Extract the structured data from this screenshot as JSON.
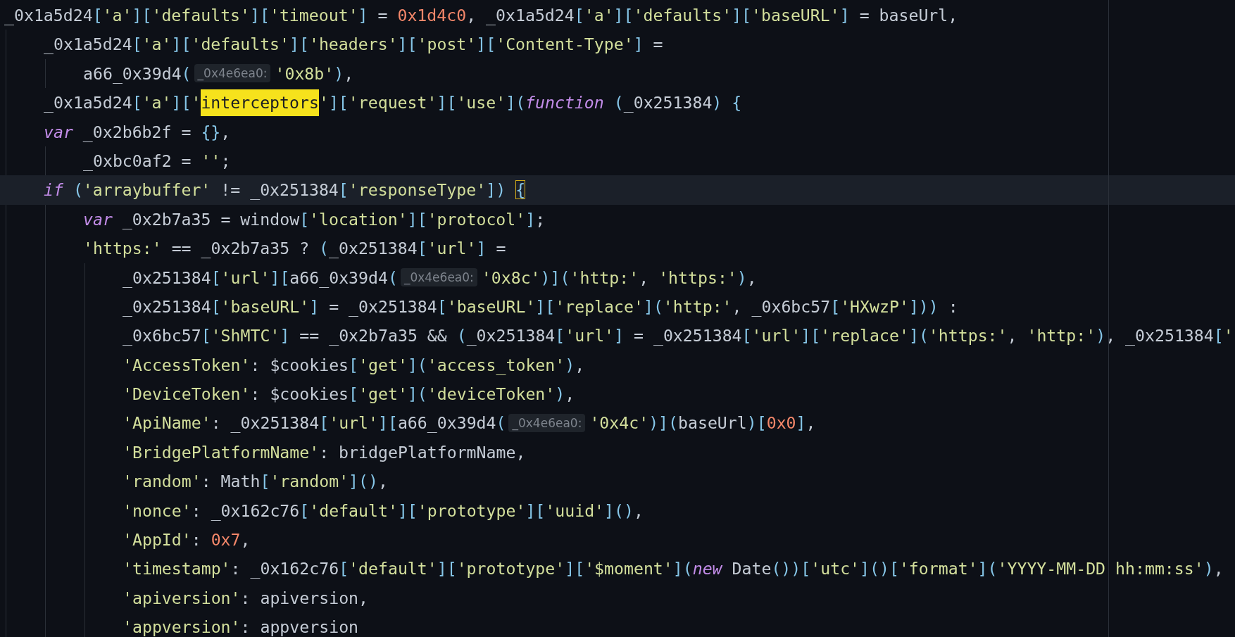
{
  "lines": [
    {
      "current": false,
      "tokens": [
        {
          "kind": "id",
          "text": "_0x1a5d24"
        },
        {
          "kind": "p",
          "text": "["
        },
        {
          "kind": "s",
          "text": "'a'"
        },
        {
          "kind": "p",
          "text": "]["
        },
        {
          "kind": "s",
          "text": "'defaults'"
        },
        {
          "kind": "p",
          "text": "]["
        },
        {
          "kind": "s",
          "text": "'timeout'"
        },
        {
          "kind": "p",
          "text": "]"
        },
        {
          "kind": "id",
          "text": " = "
        },
        {
          "kind": "n",
          "text": "0x1d4c0"
        },
        {
          "kind": "id",
          "text": ", _0x1a5d24"
        },
        {
          "kind": "p",
          "text": "["
        },
        {
          "kind": "s",
          "text": "'a'"
        },
        {
          "kind": "p",
          "text": "]["
        },
        {
          "kind": "s",
          "text": "'defaults'"
        },
        {
          "kind": "p",
          "text": "]["
        },
        {
          "kind": "s",
          "text": "'baseURL'"
        },
        {
          "kind": "p",
          "text": "]"
        },
        {
          "kind": "id",
          "text": " = baseUrl,"
        }
      ],
      "children": [
        {
          "current": false,
          "tokens": [
            {
              "kind": "id",
              "text": "_0x1a5d24"
            },
            {
              "kind": "p",
              "text": "["
            },
            {
              "kind": "s",
              "text": "'a'"
            },
            {
              "kind": "p",
              "text": "]["
            },
            {
              "kind": "s",
              "text": "'defaults'"
            },
            {
              "kind": "p",
              "text": "]["
            },
            {
              "kind": "s",
              "text": "'headers'"
            },
            {
              "kind": "p",
              "text": "]["
            },
            {
              "kind": "s",
              "text": "'post'"
            },
            {
              "kind": "p",
              "text": "]["
            },
            {
              "kind": "s",
              "text": "'Content-Type'"
            },
            {
              "kind": "p",
              "text": "]"
            },
            {
              "kind": "id",
              "text": " ="
            }
          ],
          "children": [
            {
              "current": false,
              "tokens": [
                {
                  "kind": "id",
                  "text": "a66_0x39d4"
                },
                {
                  "kind": "p",
                  "text": "("
                },
                {
                  "kind": "hint",
                  "text": "_0x4e6ea0:"
                },
                {
                  "kind": "s",
                  "text": "'0x8b'"
                },
                {
                  "kind": "p",
                  "text": ")"
                },
                {
                  "kind": "id",
                  "text": ","
                }
              ]
            }
          ]
        },
        {
          "current": false,
          "tokens": [
            {
              "kind": "id",
              "text": "_0x1a5d24"
            },
            {
              "kind": "p",
              "text": "["
            },
            {
              "kind": "s",
              "text": "'a'"
            },
            {
              "kind": "p",
              "text": "]["
            },
            {
              "kind": "s",
              "text": "'"
            },
            {
              "kind": "match",
              "text": "interceptors"
            },
            {
              "kind": "s",
              "text": "'"
            },
            {
              "kind": "p",
              "text": "]["
            },
            {
              "kind": "s",
              "text": "'request'"
            },
            {
              "kind": "p",
              "text": "]["
            },
            {
              "kind": "s",
              "text": "'use'"
            },
            {
              "kind": "p",
              "text": "]("
            },
            {
              "kind": "kw",
              "text": "function"
            },
            {
              "kind": "p",
              "text": " ("
            },
            {
              "kind": "id",
              "text": "_0x251384"
            },
            {
              "kind": "p",
              "text": ") {"
            }
          ]
        },
        {
          "current": false,
          "tokens": [
            {
              "kind": "kw",
              "text": "var"
            },
            {
              "kind": "id",
              "text": " _0x2b6b2f = "
            },
            {
              "kind": "p",
              "text": "{}"
            },
            {
              "kind": "id",
              "text": ","
            }
          ],
          "children": [
            {
              "current": false,
              "tokens": [
                {
                  "kind": "id",
                  "text": "_0xbc0af2 = "
                },
                {
                  "kind": "s",
                  "text": "''"
                },
                {
                  "kind": "id",
                  "text": ";"
                }
              ]
            }
          ]
        },
        {
          "current": true,
          "tokens": [
            {
              "kind": "kw",
              "text": "if"
            },
            {
              "kind": "p",
              "text": " ("
            },
            {
              "kind": "s",
              "text": "'arraybuffer'"
            },
            {
              "kind": "id",
              "text": " != _0x251384"
            },
            {
              "kind": "p",
              "text": "["
            },
            {
              "kind": "s",
              "text": "'responseType'"
            },
            {
              "kind": "p",
              "text": "]) "
            },
            {
              "kind": "brace",
              "text": "{"
            }
          ],
          "children": [
            {
              "current": false,
              "tokens": [
                {
                  "kind": "kw",
                  "text": "var"
                },
                {
                  "kind": "id",
                  "text": " _0x2b7a35 = window"
                },
                {
                  "kind": "p",
                  "text": "["
                },
                {
                  "kind": "s",
                  "text": "'location'"
                },
                {
                  "kind": "p",
                  "text": "]["
                },
                {
                  "kind": "s",
                  "text": "'protocol'"
                },
                {
                  "kind": "p",
                  "text": "]"
                },
                {
                  "kind": "id",
                  "text": ";"
                }
              ]
            },
            {
              "current": false,
              "tokens": [
                {
                  "kind": "s",
                  "text": "'https:'"
                },
                {
                  "kind": "id",
                  "text": " == _0x2b7a35 ? "
                },
                {
                  "kind": "p",
                  "text": "("
                },
                {
                  "kind": "id",
                  "text": "_0x251384"
                },
                {
                  "kind": "p",
                  "text": "["
                },
                {
                  "kind": "s",
                  "text": "'url'"
                },
                {
                  "kind": "p",
                  "text": "]"
                },
                {
                  "kind": "id",
                  "text": " ="
                }
              ],
              "children": [
                {
                  "current": false,
                  "tokens": [
                    {
                      "kind": "id",
                      "text": "_0x251384"
                    },
                    {
                      "kind": "p",
                      "text": "["
                    },
                    {
                      "kind": "s",
                      "text": "'url'"
                    },
                    {
                      "kind": "p",
                      "text": "]["
                    },
                    {
                      "kind": "id",
                      "text": "a66_0x39d4"
                    },
                    {
                      "kind": "p",
                      "text": "("
                    },
                    {
                      "kind": "hint",
                      "text": "_0x4e6ea0:"
                    },
                    {
                      "kind": "s",
                      "text": "'0x8c'"
                    },
                    {
                      "kind": "p",
                      "text": ")]("
                    },
                    {
                      "kind": "s",
                      "text": "'http:'"
                    },
                    {
                      "kind": "id",
                      "text": ", "
                    },
                    {
                      "kind": "s",
                      "text": "'https:'"
                    },
                    {
                      "kind": "p",
                      "text": ")"
                    },
                    {
                      "kind": "id",
                      "text": ","
                    }
                  ]
                },
                {
                  "current": false,
                  "tokens": [
                    {
                      "kind": "id",
                      "text": "_0x251384"
                    },
                    {
                      "kind": "p",
                      "text": "["
                    },
                    {
                      "kind": "s",
                      "text": "'baseURL'"
                    },
                    {
                      "kind": "p",
                      "text": "]"
                    },
                    {
                      "kind": "id",
                      "text": " = _0x251384"
                    },
                    {
                      "kind": "p",
                      "text": "["
                    },
                    {
                      "kind": "s",
                      "text": "'baseURL'"
                    },
                    {
                      "kind": "p",
                      "text": "]["
                    },
                    {
                      "kind": "s",
                      "text": "'replace'"
                    },
                    {
                      "kind": "p",
                      "text": "]("
                    },
                    {
                      "kind": "s",
                      "text": "'http:'"
                    },
                    {
                      "kind": "id",
                      "text": ", _0x6bc57"
                    },
                    {
                      "kind": "p",
                      "text": "["
                    },
                    {
                      "kind": "s",
                      "text": "'HXwzP'"
                    },
                    {
                      "kind": "p",
                      "text": "]))"
                    },
                    {
                      "kind": "id",
                      "text": " :"
                    }
                  ]
                },
                {
                  "current": false,
                  "tokens": [
                    {
                      "kind": "id",
                      "text": "_0x6bc57"
                    },
                    {
                      "kind": "p",
                      "text": "["
                    },
                    {
                      "kind": "s",
                      "text": "'ShMTC'"
                    },
                    {
                      "kind": "p",
                      "text": "]"
                    },
                    {
                      "kind": "id",
                      "text": " == _0x2b7a35 && "
                    },
                    {
                      "kind": "p",
                      "text": "("
                    },
                    {
                      "kind": "id",
                      "text": "_0x251384"
                    },
                    {
                      "kind": "p",
                      "text": "["
                    },
                    {
                      "kind": "s",
                      "text": "'url'"
                    },
                    {
                      "kind": "p",
                      "text": "]"
                    },
                    {
                      "kind": "id",
                      "text": " = _0x251384"
                    },
                    {
                      "kind": "p",
                      "text": "["
                    },
                    {
                      "kind": "s",
                      "text": "'url'"
                    },
                    {
                      "kind": "p",
                      "text": "]["
                    },
                    {
                      "kind": "s",
                      "text": "'replace'"
                    },
                    {
                      "kind": "p",
                      "text": "]("
                    },
                    {
                      "kind": "s",
                      "text": "'https:'"
                    },
                    {
                      "kind": "id",
                      "text": ", "
                    },
                    {
                      "kind": "s",
                      "text": "'http:'"
                    },
                    {
                      "kind": "p",
                      "text": ")"
                    },
                    {
                      "kind": "id",
                      "text": ", _0x251384"
                    },
                    {
                      "kind": "p",
                      "text": "["
                    },
                    {
                      "kind": "s",
                      "text": "'"
                    }
                  ]
                },
                {
                  "current": false,
                  "tokens": [
                    {
                      "kind": "s",
                      "text": "'AccessToken'"
                    },
                    {
                      "kind": "id",
                      "text": ": $cookies"
                    },
                    {
                      "kind": "p",
                      "text": "["
                    },
                    {
                      "kind": "s",
                      "text": "'get'"
                    },
                    {
                      "kind": "p",
                      "text": "]("
                    },
                    {
                      "kind": "s",
                      "text": "'access_token'"
                    },
                    {
                      "kind": "p",
                      "text": ")"
                    },
                    {
                      "kind": "id",
                      "text": ","
                    }
                  ]
                },
                {
                  "current": false,
                  "tokens": [
                    {
                      "kind": "s",
                      "text": "'DeviceToken'"
                    },
                    {
                      "kind": "id",
                      "text": ": $cookies"
                    },
                    {
                      "kind": "p",
                      "text": "["
                    },
                    {
                      "kind": "s",
                      "text": "'get'"
                    },
                    {
                      "kind": "p",
                      "text": "]("
                    },
                    {
                      "kind": "s",
                      "text": "'deviceToken'"
                    },
                    {
                      "kind": "p",
                      "text": ")"
                    },
                    {
                      "kind": "id",
                      "text": ","
                    }
                  ]
                },
                {
                  "current": false,
                  "tokens": [
                    {
                      "kind": "s",
                      "text": "'ApiName'"
                    },
                    {
                      "kind": "id",
                      "text": ": _0x251384"
                    },
                    {
                      "kind": "p",
                      "text": "["
                    },
                    {
                      "kind": "s",
                      "text": "'url'"
                    },
                    {
                      "kind": "p",
                      "text": "]["
                    },
                    {
                      "kind": "id",
                      "text": "a66_0x39d4"
                    },
                    {
                      "kind": "p",
                      "text": "("
                    },
                    {
                      "kind": "hint",
                      "text": "_0x4e6ea0:"
                    },
                    {
                      "kind": "s",
                      "text": "'0x4c'"
                    },
                    {
                      "kind": "p",
                      "text": ")]("
                    },
                    {
                      "kind": "id",
                      "text": "baseUrl"
                    },
                    {
                      "kind": "p",
                      "text": ")["
                    },
                    {
                      "kind": "n",
                      "text": "0x0"
                    },
                    {
                      "kind": "p",
                      "text": "]"
                    },
                    {
                      "kind": "id",
                      "text": ","
                    }
                  ]
                },
                {
                  "current": false,
                  "tokens": [
                    {
                      "kind": "s",
                      "text": "'BridgePlatformName'"
                    },
                    {
                      "kind": "id",
                      "text": ": bridgePlatformName,"
                    }
                  ]
                },
                {
                  "current": false,
                  "tokens": [
                    {
                      "kind": "s",
                      "text": "'random'"
                    },
                    {
                      "kind": "id",
                      "text": ": Math"
                    },
                    {
                      "kind": "p",
                      "text": "["
                    },
                    {
                      "kind": "s",
                      "text": "'random'"
                    },
                    {
                      "kind": "p",
                      "text": "]()"
                    },
                    {
                      "kind": "id",
                      "text": ","
                    }
                  ]
                },
                {
                  "current": false,
                  "tokens": [
                    {
                      "kind": "s",
                      "text": "'nonce'"
                    },
                    {
                      "kind": "id",
                      "text": ": _0x162c76"
                    },
                    {
                      "kind": "p",
                      "text": "["
                    },
                    {
                      "kind": "s",
                      "text": "'default'"
                    },
                    {
                      "kind": "p",
                      "text": "]["
                    },
                    {
                      "kind": "s",
                      "text": "'prototype'"
                    },
                    {
                      "kind": "p",
                      "text": "]["
                    },
                    {
                      "kind": "s",
                      "text": "'uuid'"
                    },
                    {
                      "kind": "p",
                      "text": "]()"
                    },
                    {
                      "kind": "id",
                      "text": ","
                    }
                  ]
                },
                {
                  "current": false,
                  "tokens": [
                    {
                      "kind": "s",
                      "text": "'AppId'"
                    },
                    {
                      "kind": "id",
                      "text": ": "
                    },
                    {
                      "kind": "n",
                      "text": "0x7"
                    },
                    {
                      "kind": "id",
                      "text": ","
                    }
                  ]
                },
                {
                  "current": false,
                  "tokens": [
                    {
                      "kind": "s",
                      "text": "'timestamp'"
                    },
                    {
                      "kind": "id",
                      "text": ": _0x162c76"
                    },
                    {
                      "kind": "p",
                      "text": "["
                    },
                    {
                      "kind": "s",
                      "text": "'default'"
                    },
                    {
                      "kind": "p",
                      "text": "]["
                    },
                    {
                      "kind": "s",
                      "text": "'prototype'"
                    },
                    {
                      "kind": "p",
                      "text": "]["
                    },
                    {
                      "kind": "s",
                      "text": "'$moment'"
                    },
                    {
                      "kind": "p",
                      "text": "]("
                    },
                    {
                      "kind": "kw",
                      "text": "new"
                    },
                    {
                      "kind": "id",
                      "text": " Date"
                    },
                    {
                      "kind": "p",
                      "text": "())["
                    },
                    {
                      "kind": "s",
                      "text": "'utc'"
                    },
                    {
                      "kind": "p",
                      "text": "]()["
                    },
                    {
                      "kind": "s",
                      "text": "'format'"
                    },
                    {
                      "kind": "p",
                      "text": "]("
                    },
                    {
                      "kind": "s",
                      "text": "'YYYY-MM-DD hh:mm:ss'"
                    },
                    {
                      "kind": "p",
                      "text": ")"
                    },
                    {
                      "kind": "id",
                      "text": ","
                    }
                  ]
                },
                {
                  "current": false,
                  "tokens": [
                    {
                      "kind": "s",
                      "text": "'apiversion'"
                    },
                    {
                      "kind": "id",
                      "text": ": apiversion,"
                    }
                  ]
                },
                {
                  "current": false,
                  "tokens": [
                    {
                      "kind": "s",
                      "text": "'appversion'"
                    },
                    {
                      "kind": "id",
                      "text": ": appversion"
                    }
                  ]
                }
              ]
            }
          ]
        }
      ]
    }
  ]
}
